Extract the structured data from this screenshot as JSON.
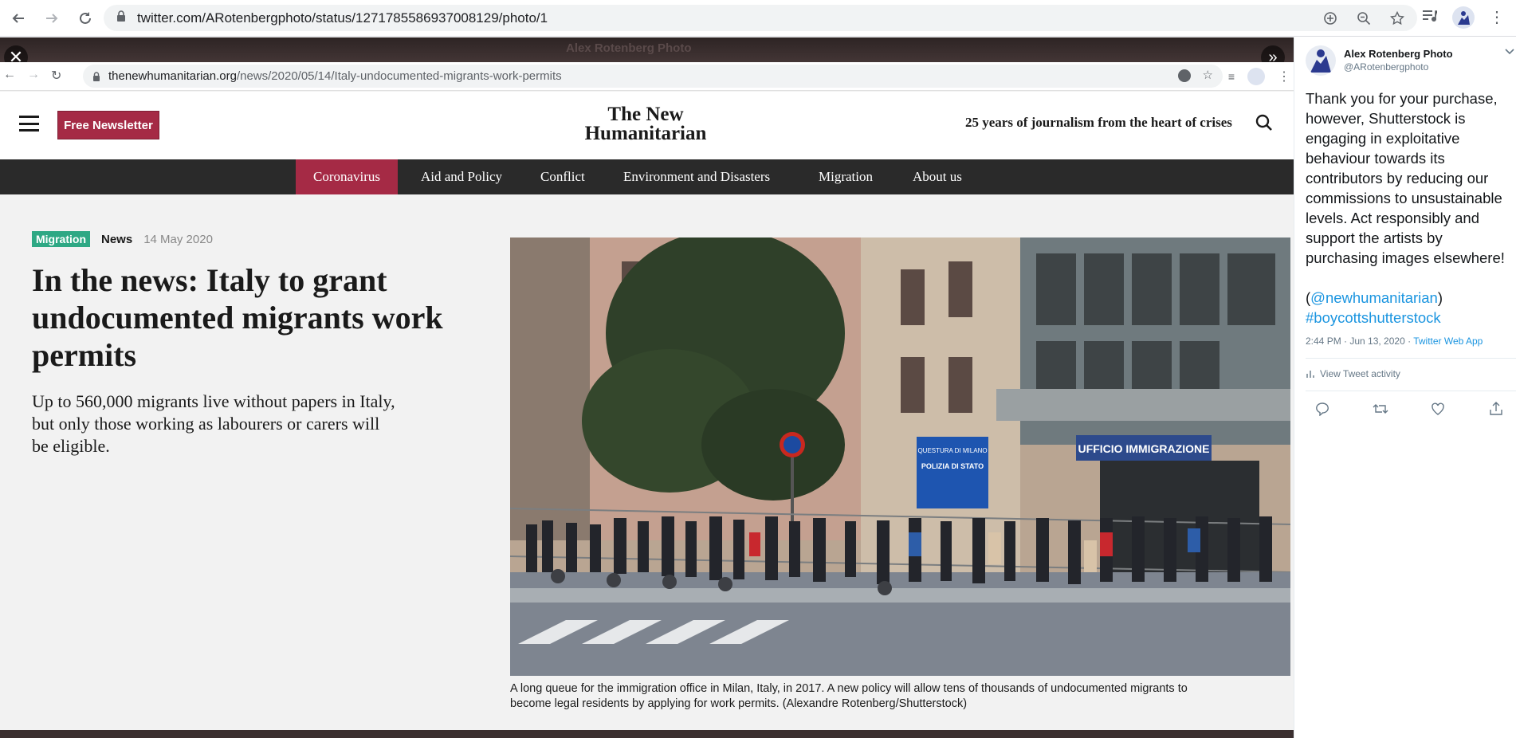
{
  "browser": {
    "url": "twitter.com/ARotenbergphoto/status/1271785586937008129/photo/1"
  },
  "frame": {
    "ghost_name": "Alex Rotenberg Photo"
  },
  "inner_browser": {
    "url_domain": "thenewhumanitarian.org",
    "url_path": "/news/2020/05/14/Italy-undocumented-migrants-work-permits"
  },
  "site": {
    "newsletter_label": "Free Newsletter",
    "logo_line1": "The New",
    "logo_line2": "Humanitarian",
    "tagline": "25 years of journalism from the heart of crises",
    "nav": [
      "Coronavirus",
      "Aid and Policy",
      "Conflict",
      "Environment and Disasters",
      "Migration",
      "About us"
    ]
  },
  "article": {
    "tag": "Migration",
    "type": "News",
    "date": "14 May 2020",
    "headline": "In the news: Italy to grant undocumented migrants work permits",
    "standfirst": "Up to 560,000 migrants live without papers in Italy, but only those working as labourers or carers will be eligible.",
    "caption": "A long queue for the immigration office in Milan, Italy, in 2017. A new policy will allow tens of thousands of undocumented migrants to become legal residents by applying for work permits. (Alexandre Rotenberg/Shutterstock)",
    "photo_sign1": "QUESTURA DI MILANO",
    "photo_sign2": "POLIZIA DI STATO",
    "photo_sign3": "UFFICIO IMMIGRAZIONE"
  },
  "tweet": {
    "author_name": "Alex Rotenberg Photo",
    "author_handle": "@ARotenbergphoto",
    "text": "Thank you for your purchase, however, Shutterstock is engaging in exploitative behaviour towards its contributors by reducing our commissions to unsustainable levels. Act responsibly and support the artists by purchasing images elsewhere!",
    "mention": "@newhumanitarian",
    "hashtag": "#boycottshutterstock",
    "time": "2:44 PM · Jun 13, 2020 · ",
    "source": "Twitter Web App",
    "activity": "View Tweet activity"
  }
}
